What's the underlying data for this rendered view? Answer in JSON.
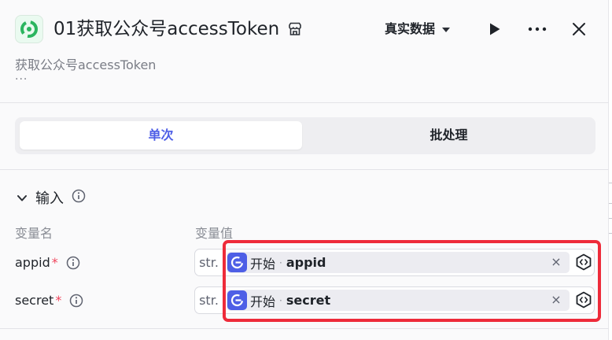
{
  "header": {
    "title": "01获取公众号accessToken",
    "description": "获取公众号accessToken",
    "more_text": "···",
    "data_mode_label": "真实数据",
    "icons": {
      "app": "app-logo-icon",
      "store": "store-icon",
      "run": "play-icon",
      "more": "more-icon",
      "close": "close-icon"
    }
  },
  "tabs": [
    {
      "label": "单次",
      "active": true
    },
    {
      "label": "批处理",
      "active": false
    }
  ],
  "inputs": {
    "section_title": "输入",
    "col_name": "变量名",
    "col_value": "变量值",
    "rows": [
      {
        "name": "appid",
        "required_mark": "*",
        "type": "str.",
        "source": "开始",
        "separator": "·",
        "variable": "appid",
        "close": "×"
      },
      {
        "name": "secret",
        "required_mark": "*",
        "type": "str.",
        "source": "开始",
        "separator": "·",
        "variable": "secret",
        "close": "×"
      }
    ]
  },
  "colors": {
    "accent": "#4e5fe6",
    "required": "#f0445b",
    "highlight": "#ee2b3a",
    "app_icon": "#2bb55f"
  }
}
